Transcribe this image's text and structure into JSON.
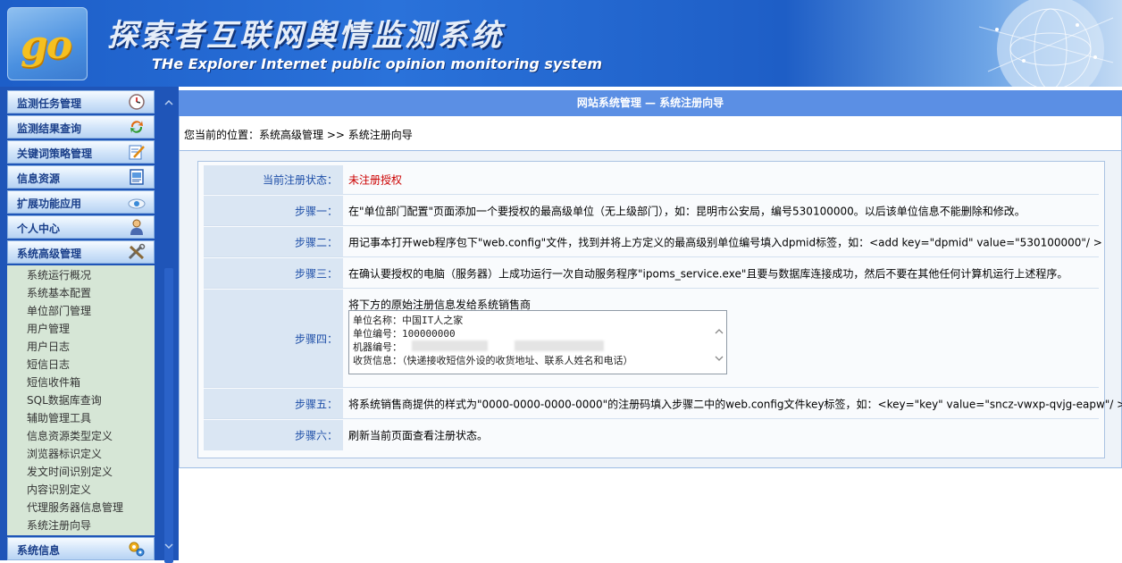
{
  "header": {
    "logo_text": "go",
    "title": "探索者互联网舆情监测系统",
    "subtitle": "THe Explorer Internet public opinion monitoring system"
  },
  "sidebar": {
    "menus": [
      {
        "label": "监测任务管理",
        "icon": "clock-icon"
      },
      {
        "label": "监测结果查询",
        "icon": "refresh-icon"
      },
      {
        "label": "关键词策略管理",
        "icon": "edit-icon"
      },
      {
        "label": "信息资源",
        "icon": "document-icon"
      },
      {
        "label": "扩展功能应用",
        "icon": "cloud-icon"
      },
      {
        "label": "个人中心",
        "icon": "user-icon"
      },
      {
        "label": "系统高级管理",
        "icon": "tools-icon"
      }
    ],
    "sub_items": [
      "系统运行概况",
      "系统基本配置",
      "单位部门管理",
      "用户管理",
      "用户日志",
      "短信日志",
      "短信收件箱",
      "SQL数据库查询",
      "辅助管理工具",
      "信息资源类型定义",
      "浏览器标识定义",
      "发文时间识别定义",
      "内容识别定义",
      "代理服务器信息管理",
      "系统注册向导"
    ],
    "last_menu": {
      "label": "系统信息",
      "icon": "gears-icon"
    }
  },
  "main": {
    "title": "网站系统管理 — 系统注册向导",
    "breadcrumb": "您当前的位置：系统高级管理 >> 系统注册向导",
    "status_label": "当前注册状态：",
    "status_value": "未注册授权",
    "status_color": "#cc0000",
    "steps": [
      {
        "label": "步骤一：",
        "text": "在\"单位部门配置\"页面添加一个要授权的最高级单位（无上级部门），如：昆明市公安局，编号530100000。以后该单位信息不能删除和修改。"
      },
      {
        "label": "步骤二：",
        "text": "用记事本打开web程序包下\"web.config\"文件，找到并将上方定义的最高级别单位编号填入dpmid标签，如：<add key=\"dpmid\" value=\"530100000\"/ >"
      },
      {
        "label": "步骤三：",
        "text": "在确认要授权的电脑（服务器）上成功运行一次自动服务程序\"ipoms_service.exe\"且要与数据库连接成功，然后不要在其他任何计算机运行上述程序。"
      },
      {
        "label": "步骤四：",
        "caption": "将下方的原始注册信息发给系统销售商",
        "reg_lines": [
          "单位名称：中国IT人之家",
          "单位编号：100000000",
          "机器编号：",
          "收货信息：（快递接收短信外设的收货地址、联系人姓名和电话）"
        ]
      },
      {
        "label": "步骤五：",
        "text": "将系统销售商提供的样式为\"0000-0000-0000-0000\"的注册码填入步骤二中的web.config文件key标签，如：<key=\"key\" value=\"sncz-vwxp-qvjg-eapw\"/ >"
      },
      {
        "label": "步骤六：",
        "text": "刷新当前页面查看注册状态。"
      }
    ]
  }
}
